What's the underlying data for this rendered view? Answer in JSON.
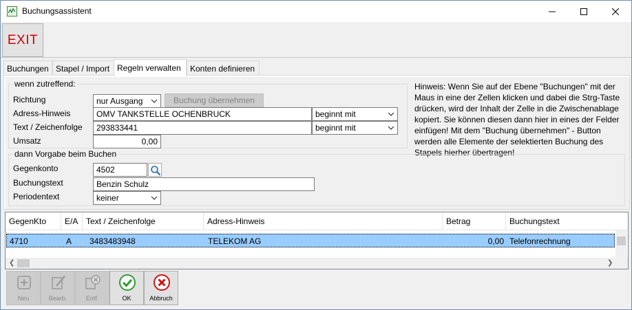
{
  "window": {
    "title": "Buchungsassistent"
  },
  "toolbar": {
    "exit_label": "EXIT"
  },
  "tabs": [
    {
      "label": "Buchungen",
      "active": false
    },
    {
      "label": "Stapel / Import",
      "active": false
    },
    {
      "label": "Regeln verwalten",
      "active": true
    },
    {
      "label": "Konten definieren",
      "active": false
    }
  ],
  "condition": {
    "legend": "wenn zutreffend:",
    "richtung_label": "Richtung",
    "richtung_value": "nur Ausgang",
    "uebernehmen_label": "Buchung übernehmen",
    "adress_label": "Adress-Hinweis",
    "adress_value": "OMV TANKSTELLE OCHENBRUCK",
    "adress_match": "beginnt mit",
    "text_label": "Text / Zeichenfolge",
    "text_value": "293833441",
    "text_match": "beginnt mit",
    "umsatz_label": "Umsatz",
    "umsatz_value": "0,00"
  },
  "preset": {
    "legend": "dann Vorgabe beim Buchen",
    "gegenkonto_label": "Gegenkonto",
    "gegenkonto_value": "4502",
    "buchungstext_label": "Buchungstext",
    "buchungstext_value": "Benzin Schulz",
    "periodentext_label": "Periodentext",
    "periodentext_value": "keiner"
  },
  "hint": "Hinweis: Wenn Sie auf der Ebene \"Buchungen\" mit der Maus in eine der Zellen klicken und dabei die Strg-Taste drücken, wird der Inhalt der Zelle in die Zwischenablage kopiert. Sie können diesen dann hier in eines der Felder einfügen! Mit dem \"Buchung übernehmen\" - Button werden alle Elemente der selektierten Buchung des Stapels hierher übertragen!",
  "grid": {
    "columns": [
      "GegenKto",
      "E/A",
      "Text / Zeichenfolge",
      "Adress-Hinweis",
      "Betrag",
      "Buchungstext"
    ],
    "rows": [
      {
        "gegenkto": "4710",
        "ea": "A",
        "text": "3483483948",
        "adresse": "TELEKOM AG",
        "betrag": "0,00",
        "buchungstext": "Telefonrechnung"
      }
    ]
  },
  "buttons": {
    "neu": "Neu",
    "bearb": "Bearb.",
    "entf": "Entf.",
    "ok": "OK",
    "abbruch": "Abbruch"
  },
  "colors": {
    "exit_text": "#d40000",
    "selection": "#99ccff",
    "ok_green": "#2e9e2e",
    "cancel_red": "#d01010"
  }
}
